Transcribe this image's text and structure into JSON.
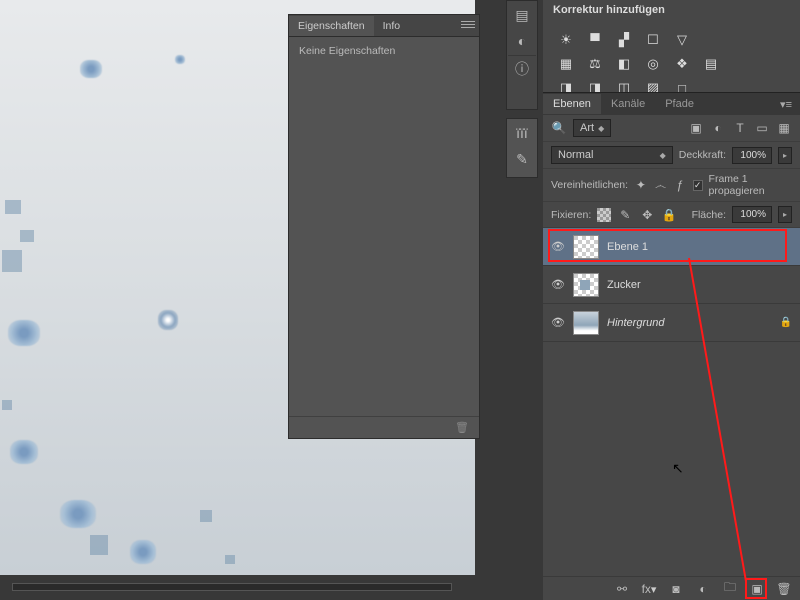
{
  "properties": {
    "tab1": "Eigenschaften",
    "tab2": "Info",
    "empty": "Keine Eigenschaften"
  },
  "adjustments": {
    "title": "Korrektur hinzufügen"
  },
  "layers": {
    "tabs": {
      "ebenen": "Ebenen",
      "kanaele": "Kanäle",
      "pfade": "Pfade"
    },
    "kind_label": "Art",
    "blend": "Normal",
    "opacity_label": "Deckkraft:",
    "opacity_val": "100%",
    "unify": "Vereinheitlichen:",
    "propagate": "Frame 1 propagieren",
    "lock_label": "Fixieren:",
    "fill_label": "Fläche:",
    "fill_val": "100%",
    "items": [
      {
        "name": "Ebene 1"
      },
      {
        "name": "Zucker"
      },
      {
        "name": "Hintergrund"
      }
    ]
  }
}
